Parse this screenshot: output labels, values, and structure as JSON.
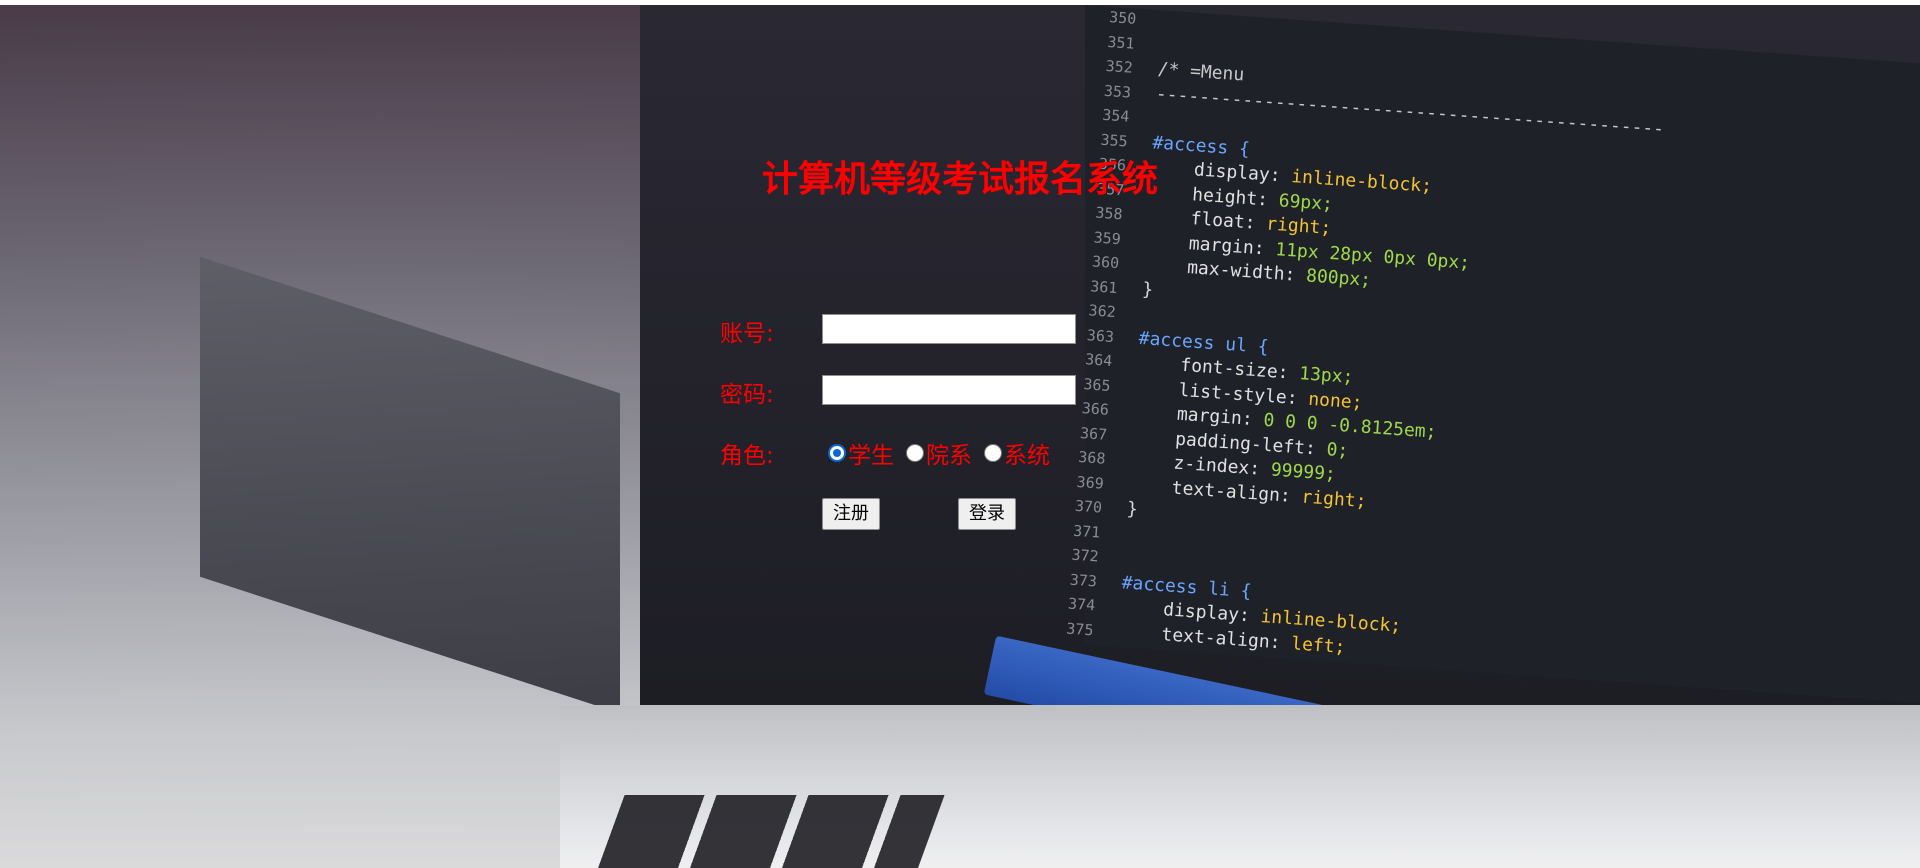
{
  "page": {
    "title": "计算机等级考试报名系统"
  },
  "form": {
    "account_label": "账号:",
    "password_label": "密码:",
    "role_label": "角色:",
    "account_value": "",
    "password_value": "",
    "roles": [
      {
        "label": "学生",
        "checked": true
      },
      {
        "label": "院系",
        "checked": false
      },
      {
        "label": "系统",
        "checked": false
      }
    ],
    "register_label": "注册",
    "login_label": "登录"
  },
  "background_code": {
    "lines": [
      {
        "n": "350",
        "text": ""
      },
      {
        "n": "351",
        "text": ""
      },
      {
        "n": "352",
        "text": "/* =Menu"
      },
      {
        "n": "353",
        "text": "-----------------------------------------------"
      },
      {
        "n": "354",
        "text": ""
      },
      {
        "n": "355",
        "text": "#access {"
      },
      {
        "n": "356",
        "text": "    display: inline-block;"
      },
      {
        "n": "357",
        "text": "    height: 69px;"
      },
      {
        "n": "358",
        "text": "    float: right;"
      },
      {
        "n": "359",
        "text": "    margin: 11px 28px 0px 0px;"
      },
      {
        "n": "360",
        "text": "    max-width: 800px;"
      },
      {
        "n": "361",
        "text": "}"
      },
      {
        "n": "362",
        "text": ""
      },
      {
        "n": "363",
        "text": "#access ul {"
      },
      {
        "n": "364",
        "text": "    font-size: 13px;"
      },
      {
        "n": "365",
        "text": "    list-style: none;"
      },
      {
        "n": "366",
        "text": "    margin: 0 0 0 -0.8125em;"
      },
      {
        "n": "367",
        "text": "    padding-left: 0;"
      },
      {
        "n": "368",
        "text": "    z-index: 99999;"
      },
      {
        "n": "369",
        "text": "    text-align: right;"
      },
      {
        "n": "370",
        "text": "}"
      },
      {
        "n": "371",
        "text": ""
      },
      {
        "n": "372",
        "text": ""
      },
      {
        "n": "373",
        "text": "#access li {"
      },
      {
        "n": "374",
        "text": "    display: inline-block;"
      },
      {
        "n": "375",
        "text": "    text-align: left;"
      }
    ]
  },
  "colors": {
    "label": "#ff0000",
    "radio_accent": "#0a64d6"
  }
}
